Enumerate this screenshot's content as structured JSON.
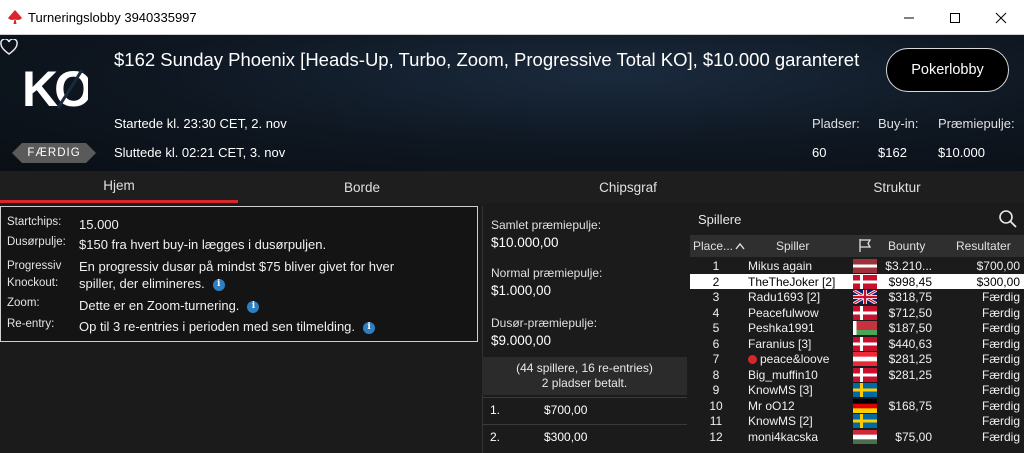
{
  "window": {
    "title": "Turneringslobby 3940335997"
  },
  "tournament": {
    "title": "$162 Sunday Phoenix [Heads-Up, Turbo, Zoom, Progressive Total KO], $10.000 garanteret",
    "status_badge": "FÆRDIG",
    "started": "Startede kl. 23:30 CET, 2. nov",
    "ended": "Sluttede kl. 02:21 CET, 3. nov",
    "lobby_button": "Pokerlobby",
    "logo_text": "KO",
    "stats": [
      {
        "label": "Pladser:",
        "value": "60"
      },
      {
        "label": "Buy-in:",
        "value": "$162"
      },
      {
        "label": "Præmiepulje:",
        "value": "$10.000"
      }
    ]
  },
  "tabs": [
    {
      "label": "Hjem",
      "active": true
    },
    {
      "label": "Borde",
      "active": false
    },
    {
      "label": "Chipsgraf",
      "active": false
    },
    {
      "label": "Struktur",
      "active": false
    }
  ],
  "info": {
    "startchips_k": "Startchips:",
    "startchips_v": "15.000",
    "bounty_k": "Dusørpulje:",
    "bounty_v": "$150 fra hvert buy-in lægges i dusørpuljen.",
    "pko_k1": "Progressiv",
    "pko_k2": "Knockout:",
    "pko_v1": "En progressiv dusør på mindst $75 bliver givet for hver",
    "pko_v2": "spiller, der elimineres.",
    "zoom_k": "Zoom:",
    "zoom_v": "Dette er en Zoom-turnering.",
    "reentry_k": "Re-entry:",
    "reentry_v": "Op til 3 re-entries i perioden med sen tilmelding."
  },
  "prize": {
    "total_label": "Samlet præmiepulje:",
    "total": "$10.000,00",
    "normal_label": "Normal præmiepulje:",
    "normal": "$1.000,00",
    "bounty_label": "Dusør-præmiepulje:",
    "bounty": "$9.000,00",
    "entries": "(44 spillere, 16 re-entries)",
    "paid": "2 pladser betalt.",
    "payouts": [
      {
        "place": "1.",
        "amount": "$700,00"
      },
      {
        "place": "2.",
        "amount": "$300,00"
      }
    ]
  },
  "players": {
    "search_placeholder": "Spillere",
    "headers": {
      "place": "Place...",
      "player": "Spiller",
      "bounty": "Bounty",
      "result": "Resultater"
    },
    "rows": [
      {
        "place": "1",
        "name": "Mikus again",
        "flag": "latvia-flag",
        "bounty": "$3.210...",
        "result": "$700,00",
        "selected": false,
        "star": false
      },
      {
        "place": "2",
        "name": "TheTheJoker [2]",
        "flag": "denmark-flag",
        "bounty": "$998,45",
        "result": "$300,00",
        "selected": true,
        "star": false
      },
      {
        "place": "3",
        "name": "Radu1693 [2]",
        "flag": "uk-flag",
        "bounty": "$318,75",
        "result": "Færdig",
        "selected": false,
        "star": false
      },
      {
        "place": "4",
        "name": "Peacefulwow",
        "flag": "denmark-flag",
        "bounty": "$712,50",
        "result": "Færdig",
        "selected": false,
        "star": false
      },
      {
        "place": "5",
        "name": "Peshka1991",
        "flag": "belarus-flag",
        "bounty": "$187,50",
        "result": "Færdig",
        "selected": false,
        "star": false
      },
      {
        "place": "6",
        "name": "Faranius [3]",
        "flag": "denmark-flag",
        "bounty": "$440,63",
        "result": "Færdig",
        "selected": false,
        "star": false
      },
      {
        "place": "7",
        "name": "peace&loove",
        "flag": "austria-flag",
        "bounty": "$281,25",
        "result": "Færdig",
        "selected": false,
        "star": true
      },
      {
        "place": "8",
        "name": "Big_muffin10",
        "flag": "denmark-flag",
        "bounty": "$281,25",
        "result": "Færdig",
        "selected": false,
        "star": false
      },
      {
        "place": "9",
        "name": "KnowMS [3]",
        "flag": "sweden-flag",
        "bounty": "",
        "result": "Færdig",
        "selected": false,
        "star": false
      },
      {
        "place": "10",
        "name": "Mr oO12",
        "flag": "germany-flag",
        "bounty": "$168,75",
        "result": "Færdig",
        "selected": false,
        "star": false
      },
      {
        "place": "11",
        "name": "KnowMS [2]",
        "flag": "sweden-flag",
        "bounty": "",
        "result": "Færdig",
        "selected": false,
        "star": false
      },
      {
        "place": "12",
        "name": "moni4kacska",
        "flag": "hungary-flag",
        "bounty": "$75,00",
        "result": "Færdig",
        "selected": false,
        "star": false
      }
    ]
  },
  "colors": {
    "accent": "#d9262c",
    "info_icon": "#2f7fc0"
  }
}
